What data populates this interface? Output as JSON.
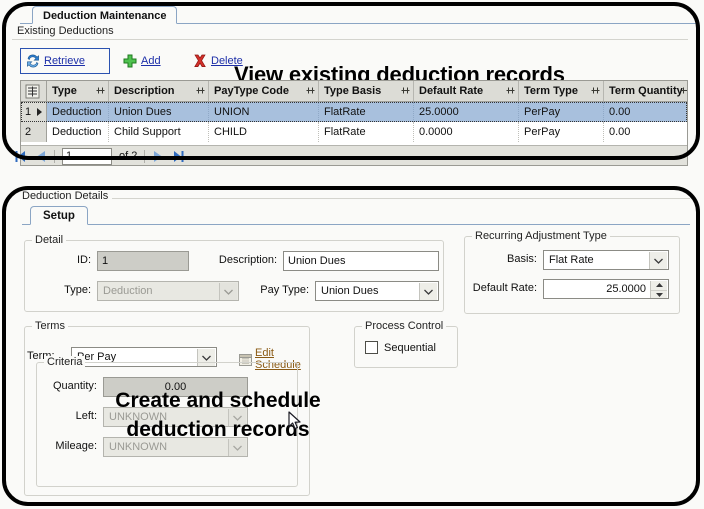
{
  "window": {
    "tab_label": "Deduction Maintenance"
  },
  "top_section": {
    "group_legend": "Existing Deductions",
    "banner": "View existing deduction records",
    "toolbar": [
      {
        "label": "Retrieve",
        "icon": "refresh-icon"
      },
      {
        "label": "Add",
        "icon": "plus-icon"
      },
      {
        "label": "Delete",
        "icon": "delete-x-icon"
      }
    ],
    "grid": {
      "columns": [
        "Type",
        "Description",
        "PayType Code",
        "Type Basis",
        "Default Rate",
        "Term Type",
        "Term Quantity"
      ],
      "rows": [
        {
          "num": "1",
          "selected": true,
          "cells": [
            "Deduction",
            "Union Dues",
            "UNION",
            "FlatRate",
            "25.0000",
            "PerPay",
            "0.00"
          ]
        },
        {
          "num": "2",
          "selected": false,
          "cells": [
            "Deduction",
            "Child Support",
            "CHILD",
            "FlatRate",
            "0.0000",
            "PerPay",
            "0.00"
          ]
        }
      ]
    },
    "navigator": {
      "page_value": "1",
      "of_label": "of 2",
      "first_icon": "first-page-icon",
      "prev_icon": "previous-page-icon",
      "next_icon": "next-page-icon",
      "last_icon": "last-page-icon"
    }
  },
  "bottom_section": {
    "group_legend": "Deduction Details",
    "tab_label": "Setup",
    "banner_line1": "Create and schedule",
    "banner_line2": "deduction records",
    "detail": {
      "legend": "Detail",
      "id_label": "ID:",
      "id_value": "1",
      "description_label": "Description:",
      "description_value": "Union Dues",
      "type_label": "Type:",
      "type_value": "Deduction",
      "paytype_label": "Pay Type:",
      "paytype_value": "Union Dues"
    },
    "recurring": {
      "legend": "Recurring Adjustment Type",
      "basis_label": "Basis:",
      "basis_value": "Flat Rate",
      "default_rate_label": "Default Rate:",
      "default_rate_value": "25.0000"
    },
    "terms": {
      "legend": "Terms",
      "term_label": "Term:",
      "term_value": "Per Pay",
      "edit_schedule_label": "Edit Schedule",
      "edit_schedule_icon": "calendar-icon"
    },
    "criteria": {
      "legend": "Criteria",
      "quantity_label": "Quantity:",
      "quantity_value": "0.00",
      "left_label": "Left:",
      "left_value": "UNKNOWN",
      "mileage_label": "Mileage:",
      "mileage_value": "UNKNOWN"
    },
    "process_control": {
      "legend": "Process Control",
      "sequential_label": "Sequential",
      "sequential_checked": false
    }
  },
  "colors": {
    "link": "#1c2ea8",
    "selection": "#a8c0dd",
    "tab_border": "#8ba5c4",
    "orange_link": "#8a5a14"
  }
}
